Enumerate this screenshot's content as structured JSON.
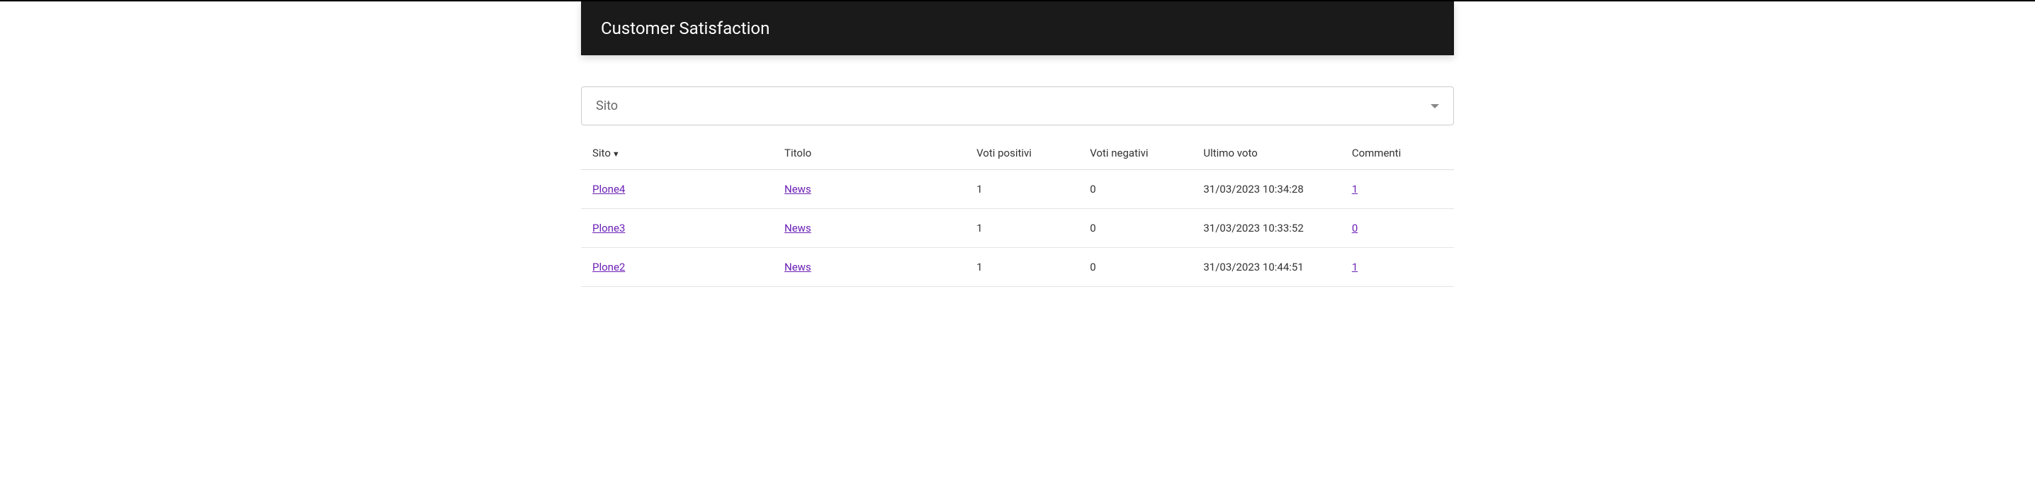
{
  "header": {
    "title": "Customer Satisfaction"
  },
  "filter": {
    "placeholder": "Sito"
  },
  "table": {
    "columns": {
      "sito": "Sito",
      "titolo": "Titolo",
      "voti_positivi": "Voti positivi",
      "voti_negativi": "Voti negativi",
      "ultimo_voto": "Ultimo voto",
      "commenti": "Commenti"
    },
    "sort_indicator": "▼",
    "rows": [
      {
        "sito": "Plone4",
        "titolo": "News",
        "voti_positivi": "1",
        "voti_negativi": "0",
        "ultimo_voto": "31/03/2023 10:34:28",
        "commenti": "1"
      },
      {
        "sito": "Plone3",
        "titolo": "News",
        "voti_positivi": "1",
        "voti_negativi": "0",
        "ultimo_voto": "31/03/2023 10:33:52",
        "commenti": "0"
      },
      {
        "sito": "Plone2",
        "titolo": "News",
        "voti_positivi": "1",
        "voti_negativi": "0",
        "ultimo_voto": "31/03/2023 10:44:51",
        "commenti": "1"
      }
    ]
  }
}
